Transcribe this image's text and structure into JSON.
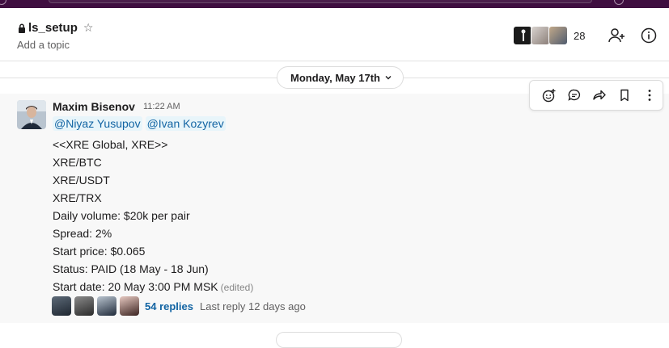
{
  "channel": {
    "name": "ls_setup",
    "topic_placeholder": "Add a topic",
    "member_count": "28"
  },
  "date_divider": {
    "label": "Monday, May 17th"
  },
  "message": {
    "sender": "Maxim Bisenov",
    "time": "11:22 AM",
    "mentions": [
      "@Niyaz Yusupov",
      "@Ivan Kozyrev"
    ],
    "lines": [
      "<<XRE Global, XRE>>",
      "XRE/BTC",
      "XRE/USDT",
      "XRE/TRX",
      "Daily volume: $20k per pair",
      "Spread: 2%",
      "Start price: $0.065",
      "Status: PAID (18 May - 18 Jun)",
      "Start date: 20 May 3:00 PM MSK"
    ],
    "edited_label": "(edited)",
    "replies": {
      "count_label": "54 replies",
      "last_reply": "Last reply 12 days ago"
    }
  },
  "icons": {
    "lock": "lock-icon",
    "star": "star-icon",
    "add_member": "add-member-icon",
    "info": "info-icon",
    "reaction": "add-reaction-icon",
    "thread": "reply-thread-icon",
    "share": "share-icon",
    "bookmark": "bookmark-icon",
    "more": "more-actions-icon",
    "chevron": "chevron-down-icon"
  },
  "colors": {
    "topbar": "#3f0e40",
    "link": "#1264a3",
    "mention_bg": "#e8f5fa",
    "message_hover_bg": "#f8f8f8"
  }
}
